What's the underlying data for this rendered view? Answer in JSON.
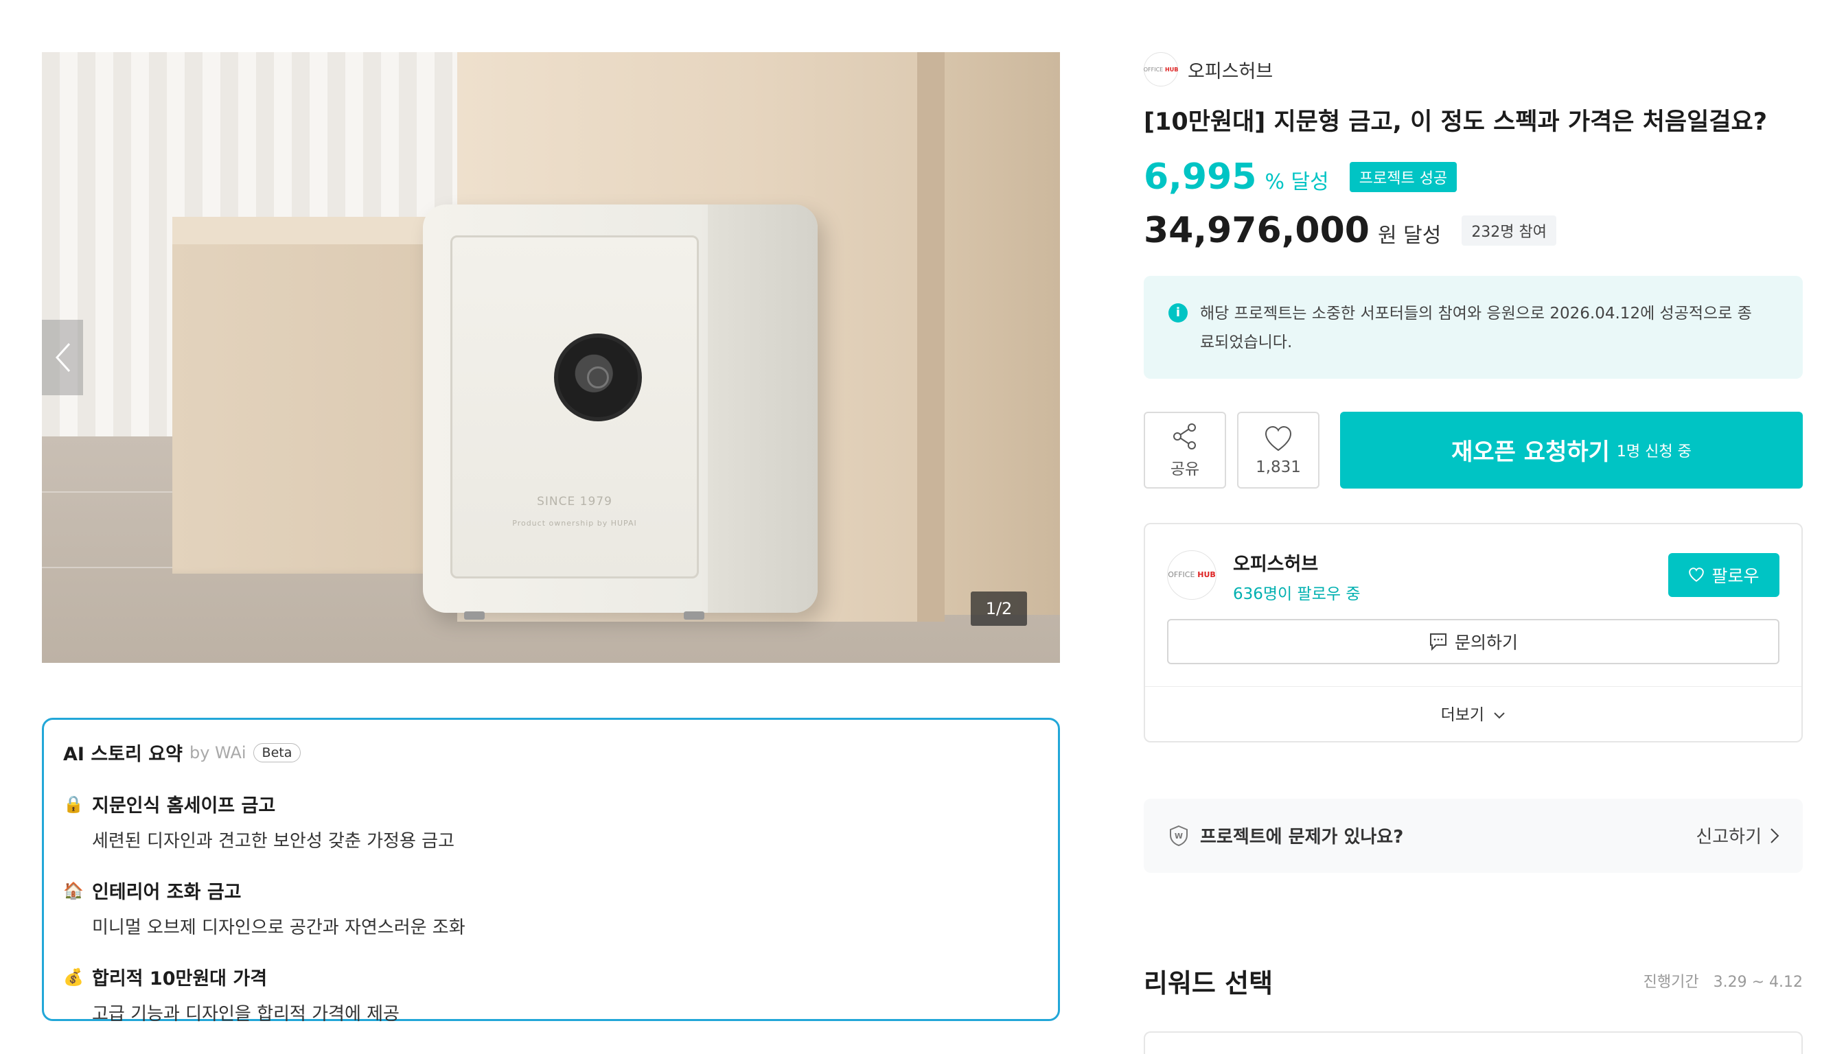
{
  "gallery": {
    "page_indicator": "1/2",
    "prev_icon": "chevron-left-icon",
    "next_icon": "chevron-right-icon",
    "safe_text_line1": "SINCE 1979",
    "safe_text_line2": "Product  ownership by  HUPAI"
  },
  "ai_summary": {
    "title": "AI 스토리 요약",
    "by": "by WAi",
    "badge": "Beta",
    "items": [
      {
        "icon": "🔒",
        "icon_name": "lock-icon",
        "title": "지문인식 홈세이프 금고",
        "desc": "세련된 디자인과 견고한 보안성 갖춘 가정용 금고"
      },
      {
        "icon": "🏠",
        "icon_name": "house-icon",
        "title": "인테리어 조화 금고",
        "desc": "미니멀 오브제 디자인으로 공간과 자연스러운 조화"
      },
      {
        "icon": "💰",
        "icon_name": "money-bag-icon",
        "title": "합리적 10만원대 가격",
        "desc": "고급 기능과 디자인을 합리적 가격에 제공"
      }
    ]
  },
  "maker": {
    "logo_text_office": "OFFICE",
    "logo_text_hub": "HUB",
    "name": "오피스허브"
  },
  "project": {
    "title": "[10만원대] 지문형 금고, 이 정도 스펙과 가격은 처음일걸요?",
    "rate": "6,995",
    "rate_unit": "% 달성",
    "status_badge": "프로젝트 성공",
    "amount": "34,976,000",
    "amount_unit": "원 달성",
    "participants": "232명 참여",
    "notice": "해당 프로젝트는 소중한 서포터들의 참여와 응원으로 2026.04.12에 성공적으로 종료되었습니다."
  },
  "actions": {
    "share_label": "공유",
    "like_count": "1,831",
    "reopen_label": "재오픈 요청하기",
    "reopen_sub": "1명 신청 중"
  },
  "maker_card": {
    "name": "오피스허브",
    "followers": "636명이 팔로우 중",
    "follow_label": "팔로우",
    "inquiry_label": "문의하기",
    "more_label": "더보기"
  },
  "report": {
    "question": "프로젝트에 문제가 있나요?",
    "link_label": "신고하기"
  },
  "reward": {
    "title": "리워드 선택",
    "period_label": "진행기간",
    "period": "3.29 ~ 4.12"
  },
  "colors": {
    "accent": "#00c4c4",
    "ai_border": "#22a7d8",
    "notice_bg": "#eaf8f8"
  }
}
